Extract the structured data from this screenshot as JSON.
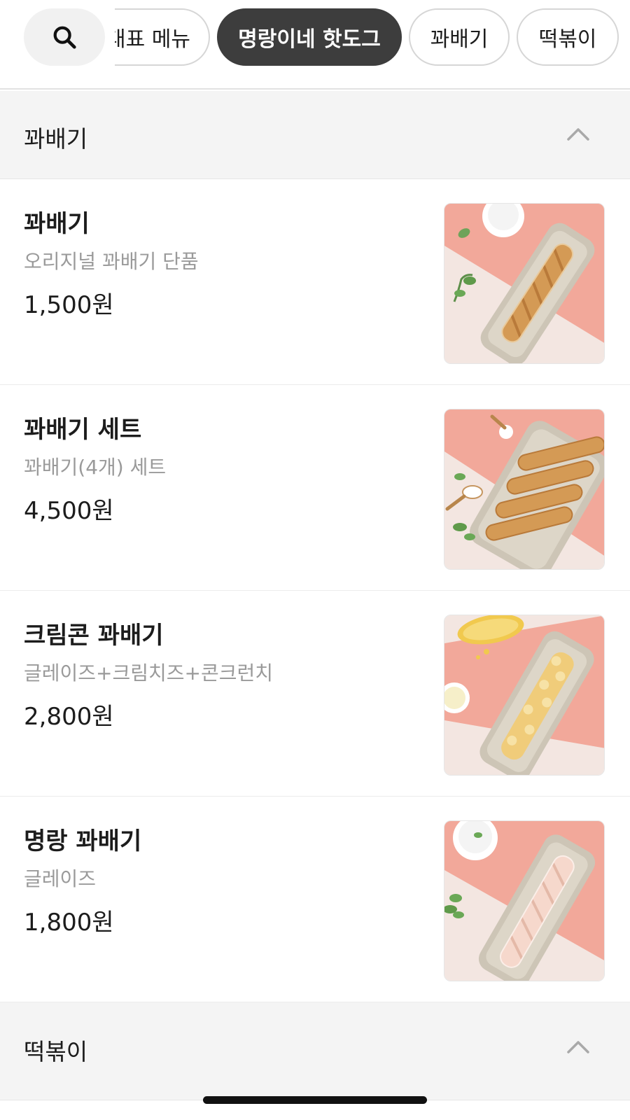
{
  "category_tabs": [
    {
      "label": "대표 메뉴",
      "active": false
    },
    {
      "label": "명랑이네 핫도그",
      "active": true
    },
    {
      "label": "꽈배기",
      "active": false
    },
    {
      "label": "떡볶이",
      "active": false
    }
  ],
  "sections": [
    {
      "title": "꽈배기",
      "expanded": true,
      "items": [
        {
          "name": "꽈배기",
          "description": "오리지널 꽈배기 단품",
          "price": "1,500원"
        },
        {
          "name": "꽈배기 세트",
          "description": "꽈배기(4개) 세트",
          "price": "4,500원"
        },
        {
          "name": "크림콘 꽈배기",
          "description": "글레이즈+크림치즈+콘크런치",
          "price": "2,800원"
        },
        {
          "name": "명랑 꽈배기",
          "description": "글레이즈",
          "price": "1,800원"
        }
      ]
    },
    {
      "title": "떡볶이",
      "expanded": true
    }
  ],
  "icons": {
    "search": "search-icon",
    "collapse": "chevron-up-icon"
  },
  "colors": {
    "active_chip_bg": "#3d3d3d",
    "section_bg": "#f4f4f4",
    "photo_pink": "#f2a89a",
    "photo_cream": "#f3e6e1"
  }
}
